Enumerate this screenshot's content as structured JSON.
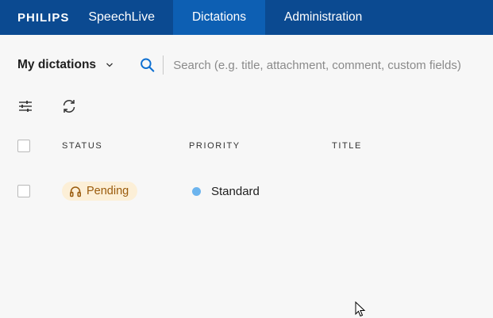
{
  "topbar": {
    "logo": "PHILIPS",
    "product": "SpeechLive",
    "tabs": [
      {
        "label": "Dictations",
        "active": true
      },
      {
        "label": "Administration",
        "active": false
      }
    ]
  },
  "toolbar": {
    "view_label": "My dictations",
    "search_placeholder": "Search (e.g. title, attachment, comment, custom fields)"
  },
  "actions": {
    "filter_icon": "sliders-icon",
    "refresh_icon": "refresh-icon"
  },
  "table": {
    "columns": [
      "STATUS",
      "PRIORITY",
      "TITLE"
    ],
    "rows": [
      {
        "status": "Pending",
        "status_icon": "headphones-icon",
        "priority": "Standard",
        "priority_color": "#6cb4ee",
        "title": ""
      }
    ]
  },
  "colors": {
    "topbar": "#0b4a91",
    "active_tab": "#0d5fb3",
    "pending_bg": "#fcefd7",
    "pending_text": "#9a5b0c",
    "accent": "#0d6fd1"
  }
}
